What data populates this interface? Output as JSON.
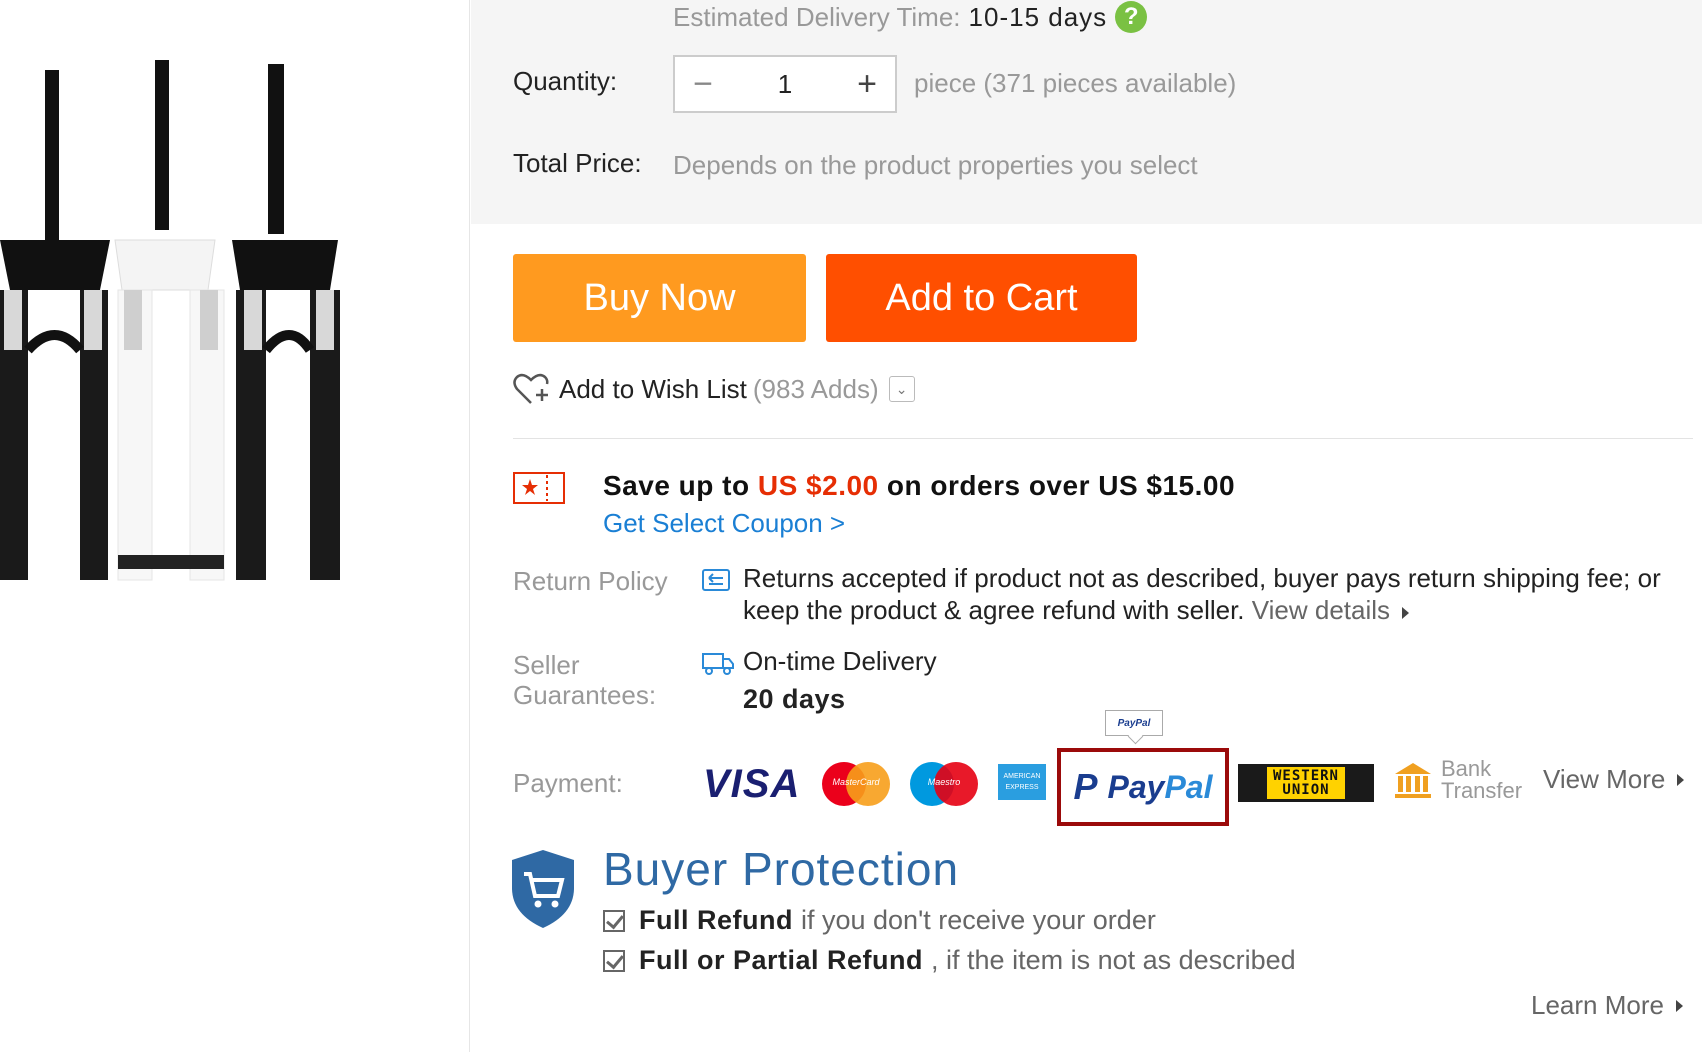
{
  "delivery": {
    "label": "Estimated Delivery Time:",
    "value": "10-15 days"
  },
  "quantity": {
    "label": "Quantity:",
    "minus": "−",
    "plus": "+",
    "value": "1",
    "availability": "piece (371 pieces available)"
  },
  "total": {
    "label": "Total Price:",
    "value": "Depends on the product properties you select"
  },
  "buttons": {
    "buy_now": "Buy Now",
    "add_to_cart": "Add to Cart"
  },
  "wishlist": {
    "label": "Add to Wish List",
    "count": "(983 Adds)"
  },
  "coupon": {
    "prefix": "Save up to ",
    "amount": "US $2.00",
    "suffix": " on orders over US $15.00",
    "link": "Get Select Coupon >"
  },
  "return_policy": {
    "label": "Return Policy",
    "text": "Returns accepted if product not as described, buyer pays return shipping fee; or keep the product & agree refund with seller.",
    "link": "View details"
  },
  "seller_guarantees": {
    "label_line1": "Seller",
    "label_line2": "Guarantees:",
    "title": "On-time Delivery",
    "days": "20 days"
  },
  "payment": {
    "label": "Payment:",
    "tooltip": "PayPal",
    "methods": {
      "visa": "VISA",
      "mastercard": "MasterCard",
      "maestro": "Maestro",
      "amex": "AMERICAN EXPRESS",
      "paypal_p": "P",
      "paypal_pay": "Pay",
      "paypal_pal": "Pal",
      "western_union_1": "WESTERN",
      "western_union_2": "UNION",
      "bank_1": "Bank",
      "bank_2": "Transfer"
    },
    "view_more": "View More"
  },
  "buyer_protection": {
    "title": "Buyer Protection",
    "items": [
      {
        "bold": "Full Refund",
        "rest": "if you don't receive your order"
      },
      {
        "bold": "Full or Partial Refund",
        "rest": ", if the item is not as described"
      }
    ],
    "learn_more": "Learn More"
  },
  "colors": {
    "buy_now": "#ff9a1f",
    "add_to_cart": "#ff4f00",
    "link_blue": "#1a7fd4",
    "price_red": "#e62e04",
    "highlight_border": "#9b0a0a",
    "protection_blue": "#2f69a4"
  }
}
